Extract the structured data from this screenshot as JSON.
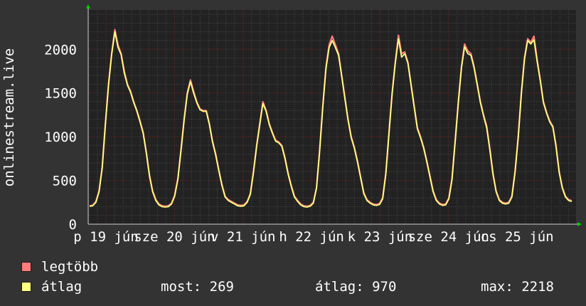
{
  "chart_data": {
    "type": "line",
    "ylabel": "onlinestream.live",
    "ylim": [
      0,
      2450
    ],
    "yticks": [
      0,
      500,
      1000,
      1500,
      2000
    ],
    "grid": true,
    "xtick_labels": [
      "p 19 jún",
      "sze 20 jún",
      "v 21 jún",
      "h 22 jún",
      "k 23 jún",
      "sze 24 jún",
      "cs 25 jún"
    ],
    "days": [
      "19",
      "20",
      "21",
      "22",
      "23",
      "24",
      "25"
    ],
    "series": [
      {
        "name": "legtöbb",
        "color": "#ff7b7b",
        "values": [
          210,
          215,
          260,
          380,
          650,
          1150,
          1600,
          1950,
          2225,
          2050,
          1950,
          1750,
          1600,
          1520,
          1400,
          1300,
          1180,
          1050,
          820,
          560,
          380,
          280,
          230,
          210,
          205,
          210,
          240,
          330,
          520,
          850,
          1200,
          1500,
          1650,
          1520,
          1400,
          1320,
          1300,
          1300,
          1150,
          950,
          800,
          620,
          450,
          320,
          280,
          260,
          240,
          220,
          215,
          220,
          260,
          350,
          600,
          900,
          1150,
          1400,
          1300,
          1150,
          1050,
          960,
          940,
          900,
          760,
          580,
          440,
          320,
          270,
          230,
          210,
          205,
          215,
          250,
          420,
          850,
          1350,
          1800,
          2050,
          2150,
          2050,
          1950,
          1700,
          1450,
          1200,
          1000,
          880,
          720,
          540,
          360,
          280,
          250,
          230,
          225,
          235,
          300,
          580,
          1050,
          1500,
          1850,
          2160,
          1950,
          1970,
          1850,
          1600,
          1350,
          1100,
          1000,
          880,
          720,
          550,
          380,
          280,
          240,
          225,
          230,
          300,
          520,
          950,
          1400,
          1800,
          2060,
          1980,
          1950,
          1800,
          1600,
          1400,
          1250,
          1120,
          860,
          580,
          380,
          280,
          250,
          240,
          250,
          320,
          600,
          1000,
          1500,
          1900,
          2120,
          2080,
          2150,
          1880,
          1650,
          1400,
          1280,
          1180,
          1120,
          900,
          600,
          420,
          320,
          280,
          269
        ]
      },
      {
        "name": "átlag",
        "color": "#ffff80",
        "values": [
          205,
          210,
          250,
          370,
          640,
          1140,
          1590,
          1940,
          2200,
          2020,
          1940,
          1730,
          1590,
          1510,
          1390,
          1290,
          1170,
          1040,
          810,
          550,
          370,
          270,
          220,
          200,
          195,
          200,
          230,
          320,
          510,
          840,
          1190,
          1490,
          1630,
          1500,
          1390,
          1310,
          1290,
          1290,
          1140,
          940,
          790,
          610,
          440,
          310,
          270,
          250,
          230,
          210,
          205,
          210,
          250,
          340,
          590,
          890,
          1140,
          1380,
          1290,
          1140,
          1040,
          950,
          930,
          890,
          750,
          570,
          430,
          310,
          260,
          220,
          200,
          195,
          205,
          240,
          410,
          840,
          1340,
          1780,
          2020,
          2100,
          2020,
          1930,
          1690,
          1440,
          1190,
          990,
          870,
          710,
          530,
          350,
          270,
          240,
          220,
          215,
          225,
          290,
          570,
          1040,
          1490,
          1840,
          2120,
          1910,
          1950,
          1840,
          1590,
          1340,
          1090,
          990,
          870,
          710,
          540,
          370,
          270,
          230,
          215,
          220,
          290,
          510,
          940,
          1390,
          1790,
          2030,
          1950,
          1930,
          1790,
          1590,
          1390,
          1240,
          1100,
          850,
          570,
          370,
          270,
          240,
          230,
          240,
          310,
          590,
          990,
          1490,
          1890,
          2100,
          2060,
          2110,
          1860,
          1640,
          1390,
          1270,
          1170,
          1110,
          890,
          590,
          410,
          310,
          270,
          260
        ]
      }
    ]
  },
  "legend": {
    "max_label": "legtöbb",
    "avg_label": "átlag",
    "max_color": "#ff7b7b",
    "avg_color": "#ffff80"
  },
  "stats": {
    "now": "most: 269",
    "avg": "átlag: 970",
    "max": "max: 2218"
  }
}
